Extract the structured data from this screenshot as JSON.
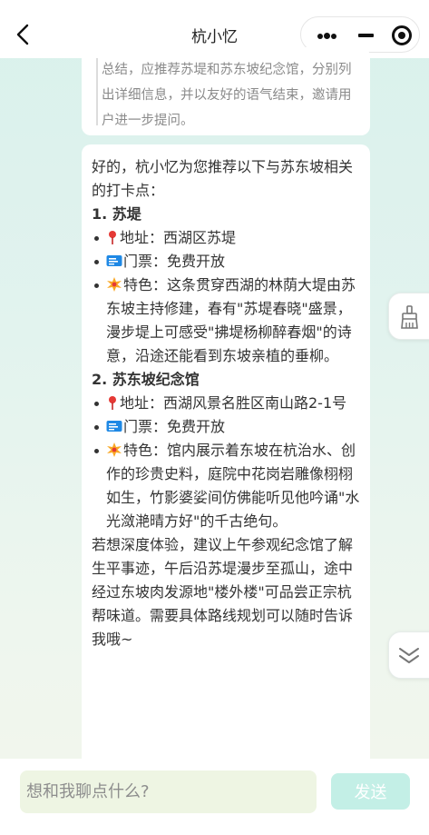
{
  "header": {
    "title": "杭小忆",
    "back_icon": "chevron-left-icon",
    "capsule": [
      "more-dots-icon",
      "minimize-icon",
      "close-target-icon"
    ]
  },
  "thinking": {
    "text": "总结，应推荐苏堤和苏东坡纪念馆，分别列出详细信息，并以友好的语气结束，邀请用户进一步提问。"
  },
  "answer": {
    "intro": "好的，杭小忆为您推荐以下与苏东坡相关的打卡点：",
    "sections": [
      {
        "title": "1. 苏堤",
        "items": [
          {
            "icon": "pin-icon",
            "text": "地址：西湖区苏堤"
          },
          {
            "icon": "ticket-icon",
            "text": "门票：免费开放"
          },
          {
            "icon": "sparkle-icon",
            "text": "特色：这条贯穿西湖的林荫大堤由苏东坡主持修建，春有\"苏堤春晓\"盛景，漫步堤上可感受\"拂堤杨柳醉春烟\"的诗意，沿途还能看到东坡亲植的垂柳。"
          }
        ]
      },
      {
        "title": "2. 苏东坡纪念馆",
        "items": [
          {
            "icon": "pin-icon",
            "text": "地址：西湖风景名胜区南山路2-1号"
          },
          {
            "icon": "ticket-icon",
            "text": "门票：免费开放"
          },
          {
            "icon": "sparkle-icon",
            "text": "特色：馆内展示着东坡在杭治水、创作的珍贵史料，庭院中花岗岩雕像栩栩如生，竹影婆娑间仿佛能听见他吟诵\"水光潋滟晴方好\"的千古绝句。"
          }
        ]
      }
    ],
    "closing": "若想深度体验，建议上午参观纪念馆了解生平事迹，午后沿苏堤漫步至孤山，途中经过东坡肉发源地\"楼外楼\"可品尝正宗杭帮味道。需要具体路线规划可以随时告诉我哦~"
  },
  "side_buttons": [
    "broom-icon",
    "double-chevron-down-icon"
  ],
  "input": {
    "placeholder": "想和我聊点什么?",
    "value": ""
  },
  "send_label": "发送",
  "colors": {
    "accent": "#c3efe6",
    "input_bg": "#eef5e3",
    "bg_top": "#d9f1ec",
    "bg_bottom": "#f3f6ec",
    "pin": "#e53935",
    "ticket": "#1e88e5",
    "sparkle": "#f9a825"
  }
}
